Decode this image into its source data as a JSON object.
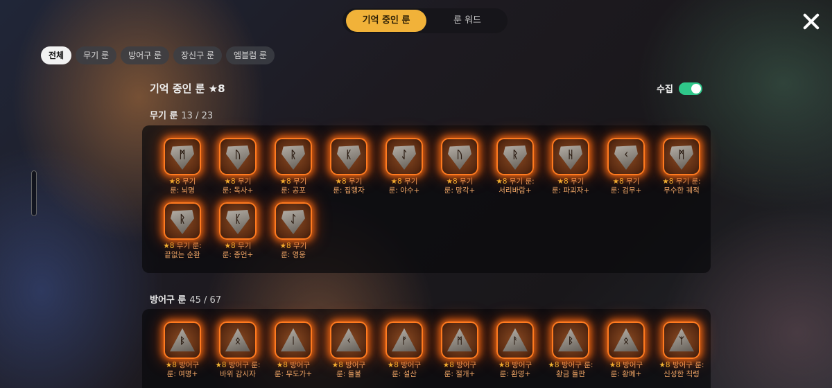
{
  "top_tabs": {
    "active": "기억 중인 룬",
    "inactive": "룬 워드"
  },
  "filters": [
    "전체",
    "무기 룬",
    "방어구 룬",
    "장신구 룬",
    "엠블럼 룬"
  ],
  "header": {
    "title": "기억 중인 룬 ★8"
  },
  "collect": {
    "label": "수집",
    "enabled": true
  },
  "sections": [
    {
      "title": "무기 룬",
      "count": "13 / 23",
      "runes": [
        {
          "glyph": "ᛗ",
          "line1": "무기",
          "line2": "룬: 뇌명"
        },
        {
          "glyph": "ᚢ",
          "line1": "무기",
          "line2": "룬: 독사+"
        },
        {
          "glyph": "ᚱ",
          "line1": "무기",
          "line2": "룬: 공포"
        },
        {
          "glyph": "ᛕ",
          "line1": "무기",
          "line2": "룬: 집행자"
        },
        {
          "glyph": "ᛇ",
          "line1": "무기",
          "line2": "룬: 야수+"
        },
        {
          "glyph": "ᚢ",
          "line1": "무기",
          "line2": "룬: 망각+"
        },
        {
          "glyph": "ᚱ",
          "line1": "무기 룬:",
          "line2": "서리바람+"
        },
        {
          "glyph": "ᚺ",
          "line1": "무기",
          "line2": "룬: 파괴자+"
        },
        {
          "glyph": "ᚲ",
          "line1": "무기",
          "line2": "룬: 검무+"
        },
        {
          "glyph": "ᛗ",
          "line1": "무기 룬:",
          "line2": "무수한 궤적"
        },
        {
          "glyph": "ᚱ",
          "line1": "무기 룬:",
          "line2": "끝없는 순환"
        },
        {
          "glyph": "ᛕ",
          "line1": "무기",
          "line2": "룬: 종언+"
        },
        {
          "glyph": "ᛇ",
          "line1": "무기",
          "line2": "룬: 영웅"
        }
      ]
    },
    {
      "title": "방어구 룬",
      "count": "45 / 67",
      "runes": [
        {
          "glyph": "ᛒ",
          "line1": "방어구",
          "line2": "룬: 여명+"
        },
        {
          "glyph": "ᛟ",
          "line1": "방어구 룬:",
          "line2": "바위 감시자"
        },
        {
          "glyph": "ᛁ",
          "line1": "방어구",
          "line2": "룬: 무도가+"
        },
        {
          "glyph": "ᚲ",
          "line1": "방어구",
          "line2": "룬: 들불"
        },
        {
          "glyph": "ᚠ",
          "line1": "방어구",
          "line2": "룬: 설산"
        },
        {
          "glyph": "ᛗ",
          "line1": "방어구",
          "line2": "룬: 절개+"
        },
        {
          "glyph": "ᚨ",
          "line1": "방어구",
          "line2": "룬: 환영+"
        },
        {
          "glyph": "ᛒ",
          "line1": "방어구 룬:",
          "line2": "황금 들판"
        },
        {
          "glyph": "ᛟ",
          "line1": "방어구",
          "line2": "룬: 황폐+"
        },
        {
          "glyph": "ᛉ",
          "line1": "방어구 룬:",
          "line2": "신성한 칙령"
        }
      ]
    }
  ],
  "rune_star_label": "★8",
  "colors": {
    "accent": "#f1b239",
    "toggle_on": "#2fc78a",
    "rune_glow": "#ff7a1f",
    "caption": "#f0a868"
  }
}
